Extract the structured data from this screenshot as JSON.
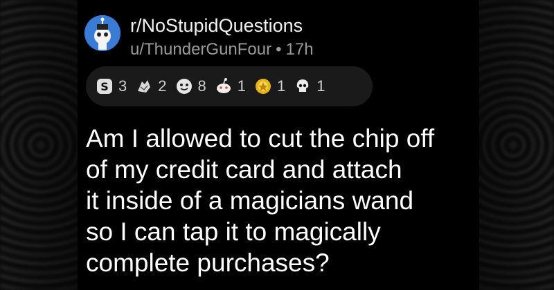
{
  "post": {
    "subreddit": "r/NoStupidQuestions",
    "author": "u/ThunderGunFour",
    "separator": "•",
    "age": "17h",
    "title_lines": [
      "Am I allowed to cut the chip off",
      "of my credit card and attach",
      "it inside of a magicians wand",
      "so I can tap it to magically",
      "complete purchases?"
    ]
  },
  "awards": [
    {
      "icon": "silver-award-icon",
      "count": "3"
    },
    {
      "icon": "hands-award-icon",
      "count": "2"
    },
    {
      "icon": "face-award-icon",
      "count": "8"
    },
    {
      "icon": "snoo-award-icon",
      "count": "1"
    },
    {
      "icon": "gold-award-icon",
      "count": "1"
    },
    {
      "icon": "skull-award-icon",
      "count": "1"
    }
  ],
  "colors": {
    "background": "#000000",
    "text": "#ffffff",
    "meta": "#9a9a9a",
    "award_pill": "#1a1a1a",
    "avatar": "#3a7bd5"
  }
}
